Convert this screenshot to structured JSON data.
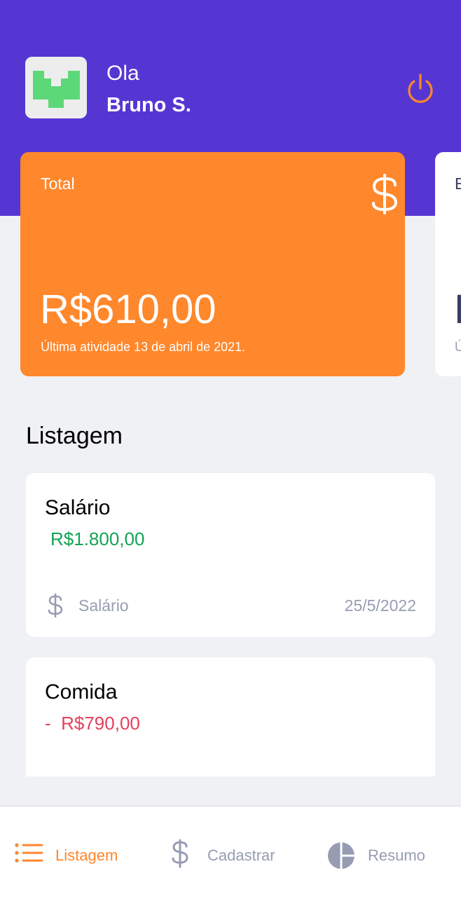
{
  "colors": {
    "header": "#5636D3",
    "accent": "#FF872C",
    "income": "#12A454",
    "outcome": "#E83F5B",
    "muted": "#969CB2",
    "background": "#F0F1F5"
  },
  "header": {
    "greeting": "Ola",
    "user_name": "Bruno S.",
    "avatar_icon": "app-logo",
    "logout_icon": "power-icon"
  },
  "cards": {
    "total": {
      "label": "Total",
      "icon": "dollar-sign-icon",
      "amount": "R$610,00",
      "last_activity": "Última atividade 13 de abril de 2021."
    },
    "next": {
      "label": "E",
      "amount": "I",
      "last_activity": "Ú"
    }
  },
  "list": {
    "title": "Listagem",
    "transactions": [
      {
        "title": "Salário",
        "amount": "R$1.800,00",
        "type": "income",
        "category_icon": "dollar-sign-icon",
        "category": "Salário",
        "date": "25/5/2022"
      },
      {
        "title": "Comida",
        "amount": "-  R$790,00",
        "type": "outcome"
      }
    ]
  },
  "tabbar": {
    "tabs": [
      {
        "label": "Listagem",
        "icon": "list-icon",
        "active": true
      },
      {
        "label": "Cadastrar",
        "icon": "dollar-sign-icon",
        "active": false
      },
      {
        "label": "Resumo",
        "icon": "pie-chart-icon",
        "active": false
      }
    ]
  }
}
